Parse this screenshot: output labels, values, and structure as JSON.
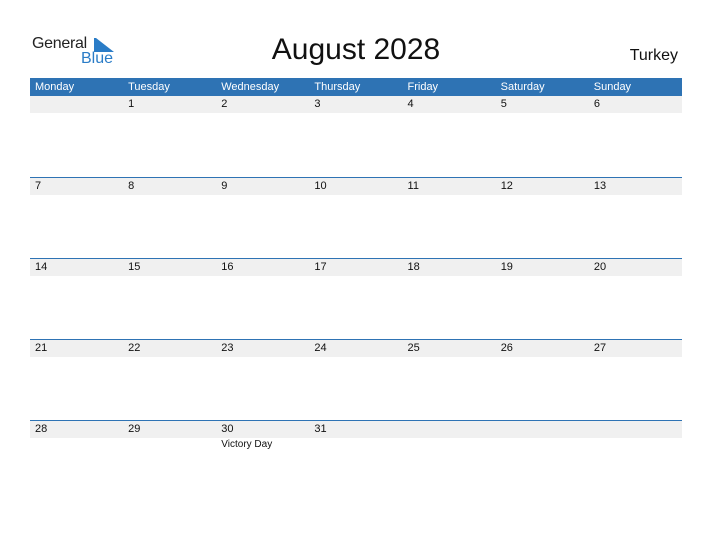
{
  "logo": {
    "word1": "General",
    "word2": "Blue",
    "icon": "flag-triangle-icon"
  },
  "title": "August 2028",
  "country": "Turkey",
  "colors": {
    "accent": "#2e73b4",
    "band": "#f0f0f0",
    "logo_blue": "#2a7cc7"
  },
  "weekdays": [
    "Monday",
    "Tuesday",
    "Wednesday",
    "Thursday",
    "Friday",
    "Saturday",
    "Sunday"
  ],
  "weeks": [
    [
      {
        "d": ""
      },
      {
        "d": "1"
      },
      {
        "d": "2"
      },
      {
        "d": "3"
      },
      {
        "d": "4"
      },
      {
        "d": "5"
      },
      {
        "d": "6"
      }
    ],
    [
      {
        "d": "7"
      },
      {
        "d": "8"
      },
      {
        "d": "9"
      },
      {
        "d": "10"
      },
      {
        "d": "11"
      },
      {
        "d": "12"
      },
      {
        "d": "13"
      }
    ],
    [
      {
        "d": "14"
      },
      {
        "d": "15"
      },
      {
        "d": "16"
      },
      {
        "d": "17"
      },
      {
        "d": "18"
      },
      {
        "d": "19"
      },
      {
        "d": "20"
      }
    ],
    [
      {
        "d": "21"
      },
      {
        "d": "22"
      },
      {
        "d": "23"
      },
      {
        "d": "24"
      },
      {
        "d": "25"
      },
      {
        "d": "26"
      },
      {
        "d": "27"
      }
    ],
    [
      {
        "d": "28"
      },
      {
        "d": "29"
      },
      {
        "d": "30",
        "h": "Victory Day"
      },
      {
        "d": "31"
      },
      {
        "d": ""
      },
      {
        "d": ""
      },
      {
        "d": ""
      }
    ]
  ]
}
